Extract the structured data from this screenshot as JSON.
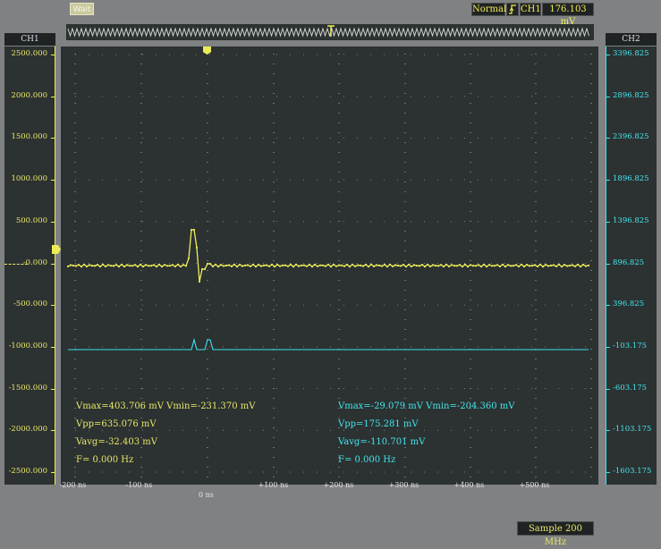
{
  "status": {
    "run_state": "Wait"
  },
  "trigger": {
    "mode": "Normal",
    "slope_icon": "rising-edge-icon",
    "source": "CH1",
    "level": "176.103 mV"
  },
  "channels": {
    "ch1": {
      "name": "CH1",
      "color": "#ecec5a",
      "ticks": [
        "2500.000",
        "2000.000",
        "1500.000",
        "1000.000",
        "500.000",
        "-0.000",
        "-500.000",
        "-1000.000",
        "-1500.000",
        "-2000.000",
        "-2500.000"
      ]
    },
    "ch2": {
      "name": "CH2",
      "color": "#3ee3ec",
      "ticks": [
        "3396.825",
        "2896.825",
        "2396.825",
        "1896.825",
        "1396.825",
        "896.825",
        "396.825",
        "-103.175",
        "-603.175",
        "-1103.175",
        "-1603.175"
      ]
    }
  },
  "time_axis": {
    "labels": [
      "-200 ns",
      "-100 ns",
      "0 ns",
      "+100 ns",
      "+200 ns",
      "+300 ns",
      "+400 ns",
      "+500 ns"
    ]
  },
  "measurements": {
    "ch1": {
      "line1": "Vmax=403.706 mV  Vmin=-231.370 mV",
      "line2": "Vpp=635.076 mV",
      "line3": "Vavg=-32.403 mV",
      "line4": "F=  0.000 Hz"
    },
    "ch2": {
      "line1": "Vmax=-29.079 mV  Vmin=-204.360 mV",
      "line2": "Vpp=175.281 mV",
      "line3": "Vavg=-110.701 mV",
      "line4": "F=  0.000 Hz"
    }
  },
  "sample_rate": "Sample 200 MHz"
}
